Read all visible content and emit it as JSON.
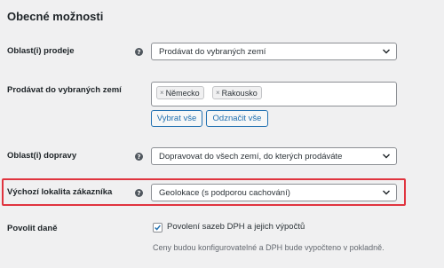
{
  "section": {
    "title": "Obecné možnosti"
  },
  "rows": {
    "selling_location": {
      "label": "Oblast(i) prodeje",
      "value": "Prodávat do vybraných zemí"
    },
    "specific_countries": {
      "label": "Prodávat do vybraných zemí",
      "tags": [
        "Německo",
        "Rakousko"
      ],
      "select_all": "Vybrat vše",
      "select_none": "Odznačit vše"
    },
    "shipping_location": {
      "label": "Oblast(i) dopravy",
      "value": "Dopravovat do všech zemí, do kterých prodáváte"
    },
    "default_customer_location": {
      "label": "Výchozí lokalita zákazníka",
      "value": "Geolokace (s podporou cachování)"
    },
    "enable_taxes": {
      "label": "Povolit daně",
      "checkbox_label": "Povolení sazeb DPH a jejich výpočtů",
      "checked": true,
      "description": "Ceny budou konfigurovatelné a DPH bude vypočteno v pokladně."
    }
  },
  "icons": {
    "help": "question-circle-icon",
    "dropdown": "chevron-down-icon",
    "remove_tag": "x-icon",
    "check": "checkmark-icon"
  },
  "colors": {
    "accent": "#2271b1",
    "highlight": "#e0343f",
    "background": "#f0f0f1"
  }
}
